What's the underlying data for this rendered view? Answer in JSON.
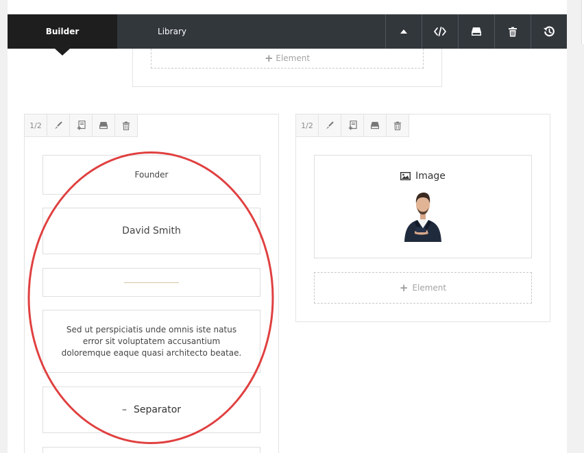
{
  "toolbar": {
    "tabs": [
      {
        "label": "Builder",
        "active": true
      },
      {
        "label": "Library",
        "active": false
      }
    ],
    "tools": [
      {
        "icon": "caret-up-icon"
      },
      {
        "icon": "code-icon"
      },
      {
        "icon": "save-drive-icon"
      },
      {
        "icon": "trash-icon"
      },
      {
        "icon": "history-icon"
      }
    ]
  },
  "top_row": {
    "add_label": "Element"
  },
  "left_column": {
    "ratio": "1/2",
    "elements": {
      "founder": "Founder",
      "name": "David Smith",
      "text": "Sed ut perspiciatis unde omnis iste natus error sit voluptatem accusantium doloremque eaque quasi architecto beatae.",
      "separator_label": "Separator",
      "separator_dash": "–"
    }
  },
  "right_column": {
    "ratio": "1/2",
    "image_label": "Image",
    "add_label": "Element"
  },
  "colors": {
    "toolbar": "#32373c",
    "active_tab": "#1e1e1e",
    "annotation": "#e04040",
    "divider": "#d4c3a3"
  }
}
